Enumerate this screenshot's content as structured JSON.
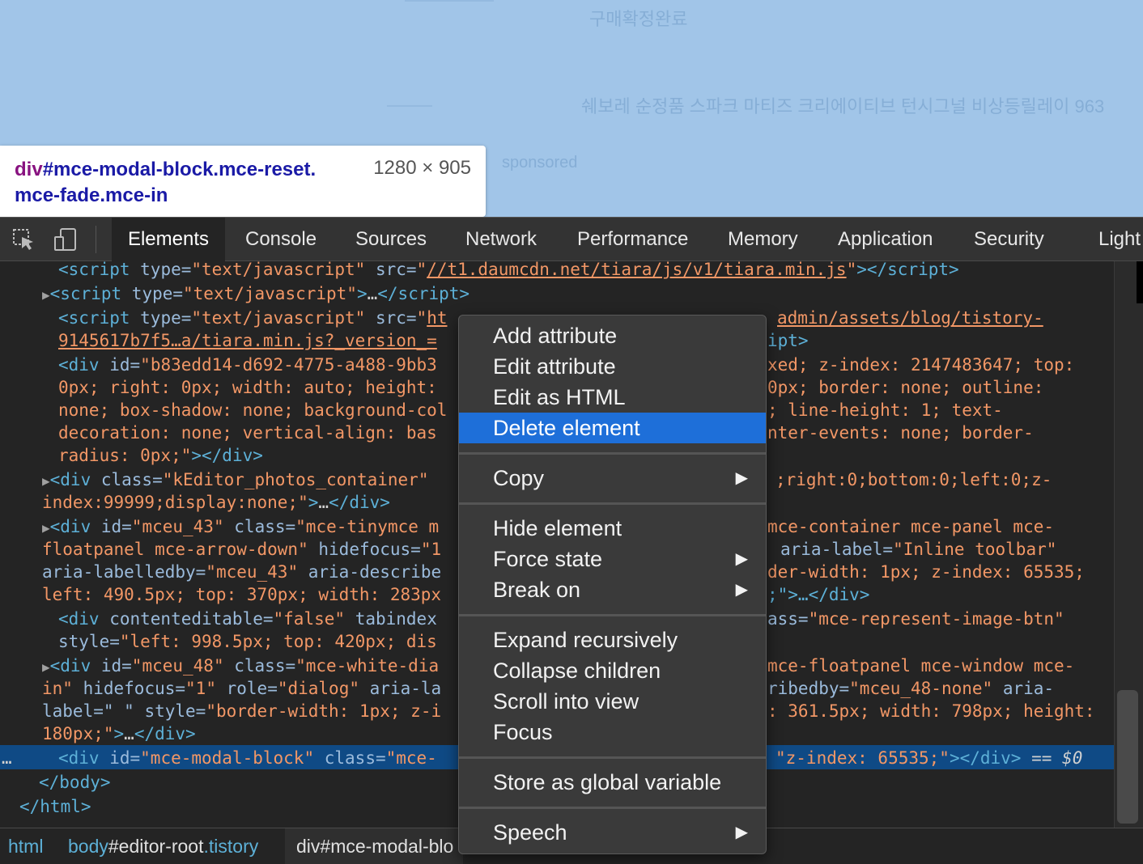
{
  "page": {
    "ghost_texts": [
      "구매확정완료",
      "쉐보레 순정품 스파크 마티즈 크리에이티브 턴시그널 비상등릴레이 963",
      "sponsored"
    ]
  },
  "tooltip": {
    "tag": "div",
    "selector_rest": "#mce-modal-block.mce-reset.",
    "selector_line2": "mce-fade.mce-in",
    "dimensions": "1280 × 905"
  },
  "toolbar": {
    "inspect_icon": "inspect-element-icon",
    "device_icon": "device-toolbar-icon"
  },
  "tabs": [
    {
      "label": "Elements",
      "active": true
    },
    {
      "label": "Console"
    },
    {
      "label": "Sources"
    },
    {
      "label": "Network"
    },
    {
      "label": "Performance"
    },
    {
      "label": "Memory"
    },
    {
      "label": "Application"
    },
    {
      "label": "Security"
    },
    {
      "label": "Light"
    }
  ],
  "code": {
    "l1_src": "//t1.daumcdn.net/tiara/js/v1/tiara.min.js",
    "l3_src_a": "ht",
    "l3_src_b": "admin/assets/blog/tistory-",
    "l4_src": "9145617b7f5…a/tiara.min.js?_version_=",
    "l4_end": "ipt>",
    "l5_id": "b83edd14-d692-4775-a488-9bb3",
    "l5_r": "xed; z-index: 2147483647; top:",
    "l6_l": "0px; right: 0px; width: auto; height:",
    "l6_r": "0px; border: none; outline:",
    "l7_l": "none; box-shadow: none; background-col",
    "l7_r": "; line-height: 1; text-",
    "l8_l": "decoration: none; vertical-align: bas",
    "l8_r": "nter-events: none; border-",
    "l9": "radius: 0px;",
    "l10_class": "kEditor_photos_container",
    "l10_r": ";right:0;bottom:0;left:0;z-",
    "l11_val": "index:99999;display:none;",
    "l12_id": "mceu_43",
    "l12_class": "mce-tinymce m",
    "l12_r": "mce-container mce-panel mce-",
    "l13_l": "floatpanel mce-arrow-down",
    "l13_hf": "1",
    "l13_r_an": "aria-label=",
    "l13_r_av": "\"Inline toolbar\"",
    "l14_l_av": "\"mceu_43\"",
    "l14_desc": "aria-describe",
    "l14_r": "der-width: 1px; z-index: 65535;",
    "l15_l": "left: 490.5px; top: 370px; width: 283px",
    "l15_r": ";\">…</div>",
    "l16_ce": "\"false\"",
    "l16_ti": "tabindex",
    "l16_r_an": "ass=",
    "l16_r_av": "\"mce-represent-image-btn\"",
    "l17": "\"left: 998.5px; top: 420px; dis",
    "l18_id": "\"mceu_48\"",
    "l18_class": "\"mce-white-dia",
    "l18_r": "mce-floatpanel mce-window mce-",
    "l19_l": "in\"",
    "l19_hf": "\"1\"",
    "l19_role": "\"dialog\"",
    "l19_al": "aria-la",
    "l19_r_an": "ribedby=",
    "l19_r_av": "\"mceu_48-none\"",
    "l19_r_an2": "aria-",
    "l20_l": "label=\" \"",
    "l20_style": "\"border-width: 1px; z-i",
    "l20_r": ": 361.5px; width: 798px; height:",
    "l21": "180px;\"",
    "l22_id": "\"mce-modal-block\"",
    "l22_class": "\"mce-",
    "l22_r": "\"z-index: 65535;\"",
    "l22_eq": "== ",
    "l22_var": "$0",
    "ellipsis": "…"
  },
  "breadcrumbs": [
    {
      "tag": "html",
      "rest": ""
    },
    {
      "tag": "body",
      "rest": "#editor-root",
      "cls": ".tistory"
    },
    {
      "tag": "div",
      "rest": "#mce-modal-blo"
    }
  ],
  "context_menu": {
    "items": [
      {
        "label": "Add attribute"
      },
      {
        "label": "Edit attribute"
      },
      {
        "label": "Edit as HTML"
      },
      {
        "label": "Delete element",
        "highlighted": true
      },
      {
        "label": "Copy",
        "submenu": true
      },
      {
        "label": "Hide element"
      },
      {
        "label": "Force state",
        "submenu": true
      },
      {
        "label": "Break on",
        "submenu": true
      },
      {
        "label": "Expand recursively"
      },
      {
        "label": "Collapse children"
      },
      {
        "label": "Scroll into view"
      },
      {
        "label": "Focus"
      },
      {
        "label": "Store as global variable"
      },
      {
        "label": "Speech",
        "submenu": true
      }
    ],
    "arrow_glyph": "▶"
  },
  "colors": {
    "page_bg": "#a1c5e8",
    "panel_bg": "#242424",
    "selected_row": "#0f4a85",
    "menu_highlight": "#1e6fd9",
    "tag": "#5db0d7",
    "attr_value": "#f29766"
  }
}
